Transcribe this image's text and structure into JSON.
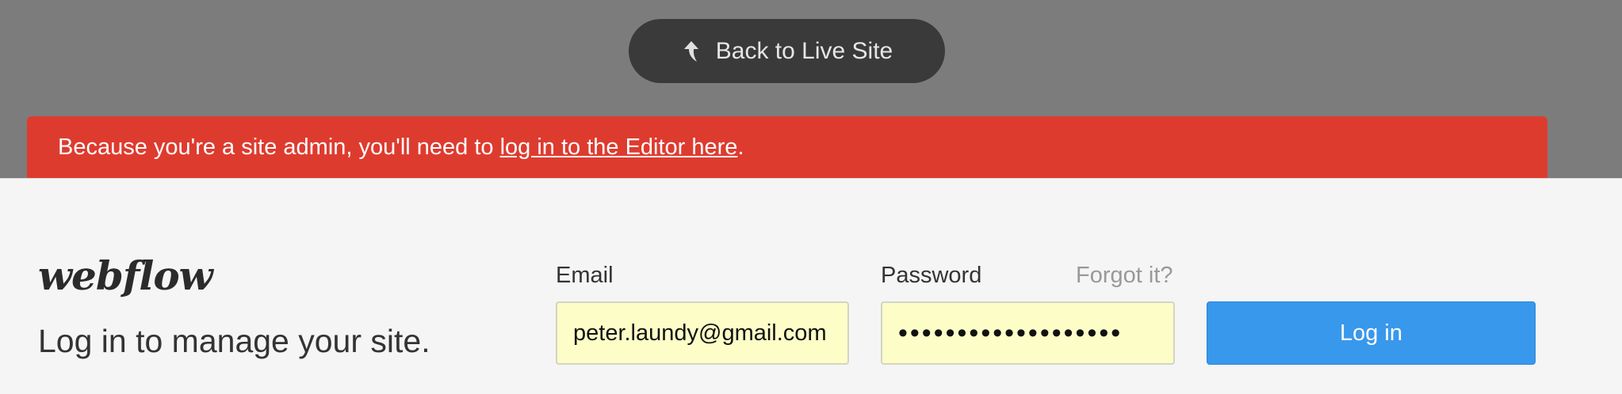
{
  "header": {
    "back_button_label": "Back to Live Site",
    "back_icon": "arrow-up-icon"
  },
  "alert": {
    "prefix": "Because you're a site admin, you'll need to ",
    "link_text": "log in to the Editor here",
    "suffix": ".",
    "color": "#de3b2f"
  },
  "login": {
    "brand": "webflow",
    "tagline": "Log in to manage your site.",
    "email_label": "Email",
    "email_value": "peter.laundy@gmail.com",
    "password_label": "Password",
    "password_value": "•••••••••••••••••••",
    "forgot_label": "Forgot it?",
    "submit_label": "Log in",
    "input_bg_color": "#fdfdc8",
    "button_color": "#3898ec"
  }
}
